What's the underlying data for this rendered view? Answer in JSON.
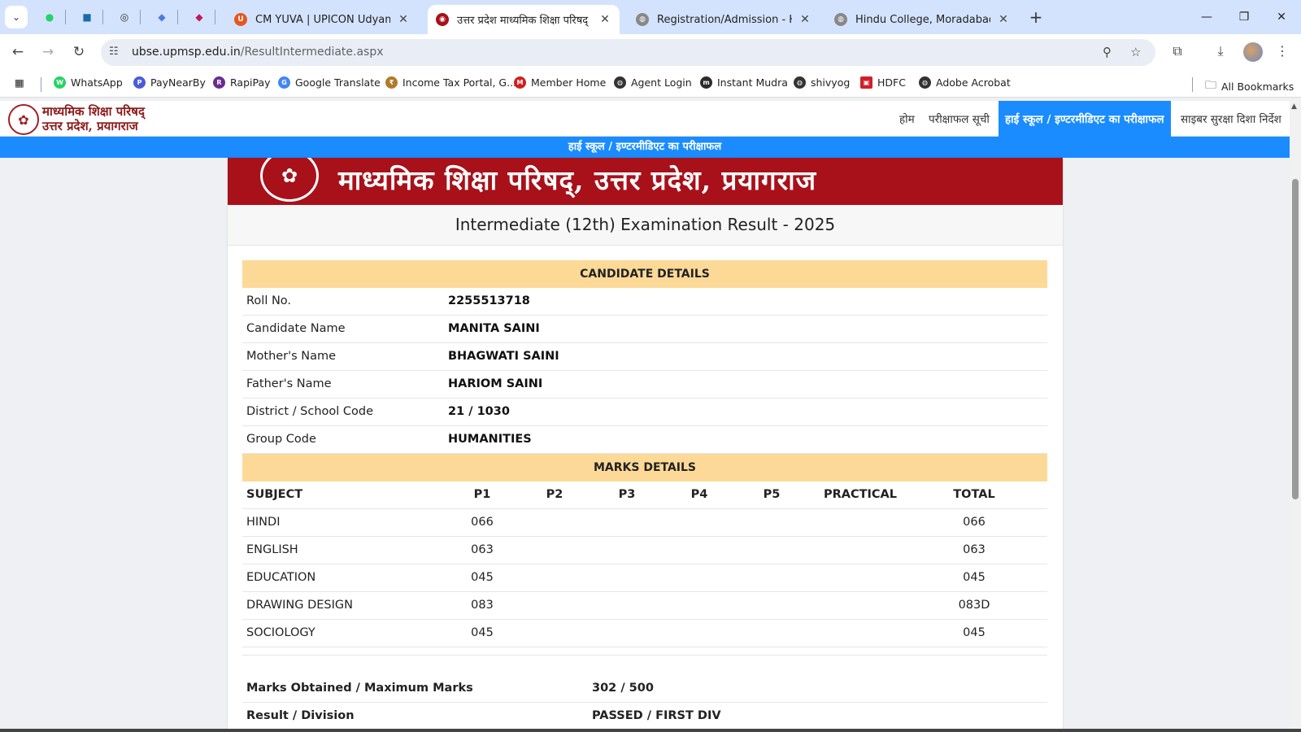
{
  "browser": {
    "tabs": [
      {
        "title": "CM YUVA | UPICON Udyami",
        "active": false
      },
      {
        "title": "उत्तर प्रदेश माध्यमिक शिक्षा परिषद्",
        "active": true
      },
      {
        "title": "Registration/Admission - Hindu",
        "active": false
      },
      {
        "title": "Hindu College, Moradabad",
        "active": false
      }
    ],
    "url_host": "ubse.upmsp.edu.in",
    "url_path": "/ResultIntermediate.aspx",
    "bookmarks": [
      "WhatsApp",
      "PayNearBy",
      "RapiPay",
      "Google Translate",
      "Income Tax Portal, G...",
      "Member Home",
      "Agent Login",
      "Instant Mudra",
      "shivyog",
      "HDFC",
      "Adobe Acrobat"
    ],
    "all_bookmarks": "All Bookmarks"
  },
  "site": {
    "logo_line1": "माध्यमिक शिक्षा परिषद्",
    "logo_line2": "उत्तर प्रदेश, प्रयागराज",
    "menu": [
      "होम",
      "परीक्षाफल सूची",
      "हाई स्कूल / इण्टरमीडिएट का परीक्षाफल",
      "साइबर सुरक्षा दिशा निर्देश"
    ],
    "strip": "हाई स्कूल / इण्टरमीडिएट का परीक्षाफल",
    "banner": "माध्यमिक शिक्षा परिषद्, उत्तर प्रदेश, प्रयागराज",
    "exam_title": "Intermediate (12th) Examination Result - 2025"
  },
  "candidate": {
    "header": "CANDIDATE DETAILS",
    "rows": [
      {
        "label": "Roll No.",
        "value": "2255513718"
      },
      {
        "label": "Candidate Name",
        "value": "MANITA SAINI"
      },
      {
        "label": "Mother's Name",
        "value": "BHAGWATI SAINI"
      },
      {
        "label": "Father's Name",
        "value": "HARIOM SAINI"
      },
      {
        "label": "District / School Code",
        "value": "21 / 1030"
      },
      {
        "label": "Group Code",
        "value": "HUMANITIES"
      }
    ]
  },
  "marks": {
    "header": "MARKS DETAILS",
    "columns": [
      "SUBJECT",
      "P1",
      "P2",
      "P3",
      "P4",
      "P5",
      "PRACTICAL",
      "TOTAL"
    ],
    "rows": [
      {
        "subject": "HINDI",
        "p1": "066",
        "p2": "",
        "p3": "",
        "p4": "",
        "p5": "",
        "practical": "",
        "total": "066"
      },
      {
        "subject": "ENGLISH",
        "p1": "063",
        "p2": "",
        "p3": "",
        "p4": "",
        "p5": "",
        "practical": "",
        "total": "063"
      },
      {
        "subject": "EDUCATION",
        "p1": "045",
        "p2": "",
        "p3": "",
        "p4": "",
        "p5": "",
        "practical": "",
        "total": "045"
      },
      {
        "subject": "DRAWING DESIGN",
        "p1": "083",
        "p2": "",
        "p3": "",
        "p4": "",
        "p5": "",
        "practical": "",
        "total": "083D"
      },
      {
        "subject": "SOCIOLOGY",
        "p1": "045",
        "p2": "",
        "p3": "",
        "p4": "",
        "p5": "",
        "practical": "",
        "total": "045"
      }
    ]
  },
  "summary": [
    {
      "label": "Marks Obtained / Maximum Marks",
      "value": "302 / 500"
    },
    {
      "label": "Result / Division",
      "value": "PASSED / FIRST DIV"
    }
  ],
  "colors": {
    "banner": "#a8111a",
    "accent": "#1a8cff",
    "section": "#fdd998"
  }
}
